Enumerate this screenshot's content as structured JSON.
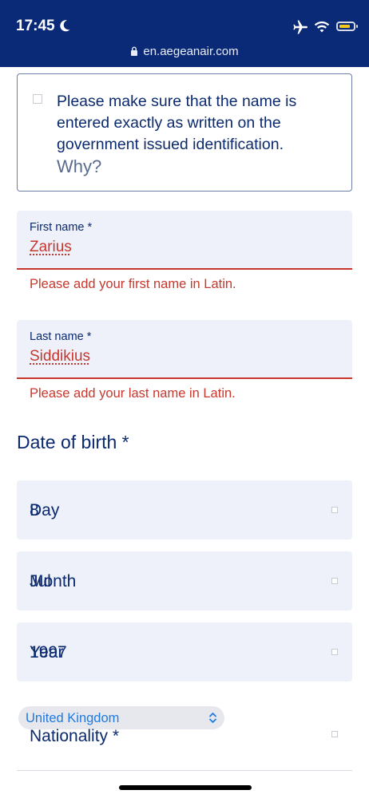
{
  "status_bar": {
    "time": "17:45",
    "icons": [
      "moon-icon",
      "airplane-icon",
      "wifi-icon",
      "battery-icon"
    ],
    "url": "en.aegeanair.com"
  },
  "notice": {
    "text": "Please make sure that the name is entered exactly as written on the government issued identification.",
    "why": "Why?",
    "checked": false
  },
  "first_name": {
    "label": "First name *",
    "value": "Zarius",
    "error": "Please add your first name in Latin."
  },
  "last_name": {
    "label": "Last name *",
    "value": "Siddikius",
    "error": "Please add your last name in Latin."
  },
  "dob": {
    "title": "Date of birth *",
    "day": {
      "placeholder": "Day",
      "value": "8"
    },
    "month": {
      "placeholder": "Month",
      "value": "Jul"
    },
    "year": {
      "placeholder": "Year",
      "value": "1997"
    }
  },
  "nationality": {
    "label": "Nationality *",
    "value": "United Kingdom"
  },
  "colors": {
    "header_bg": "#0a2a78",
    "text_primary": "#0b2a6f",
    "error": "#c8372d",
    "field_bg": "#eef1f9",
    "link_blue": "#1f7ae0"
  }
}
